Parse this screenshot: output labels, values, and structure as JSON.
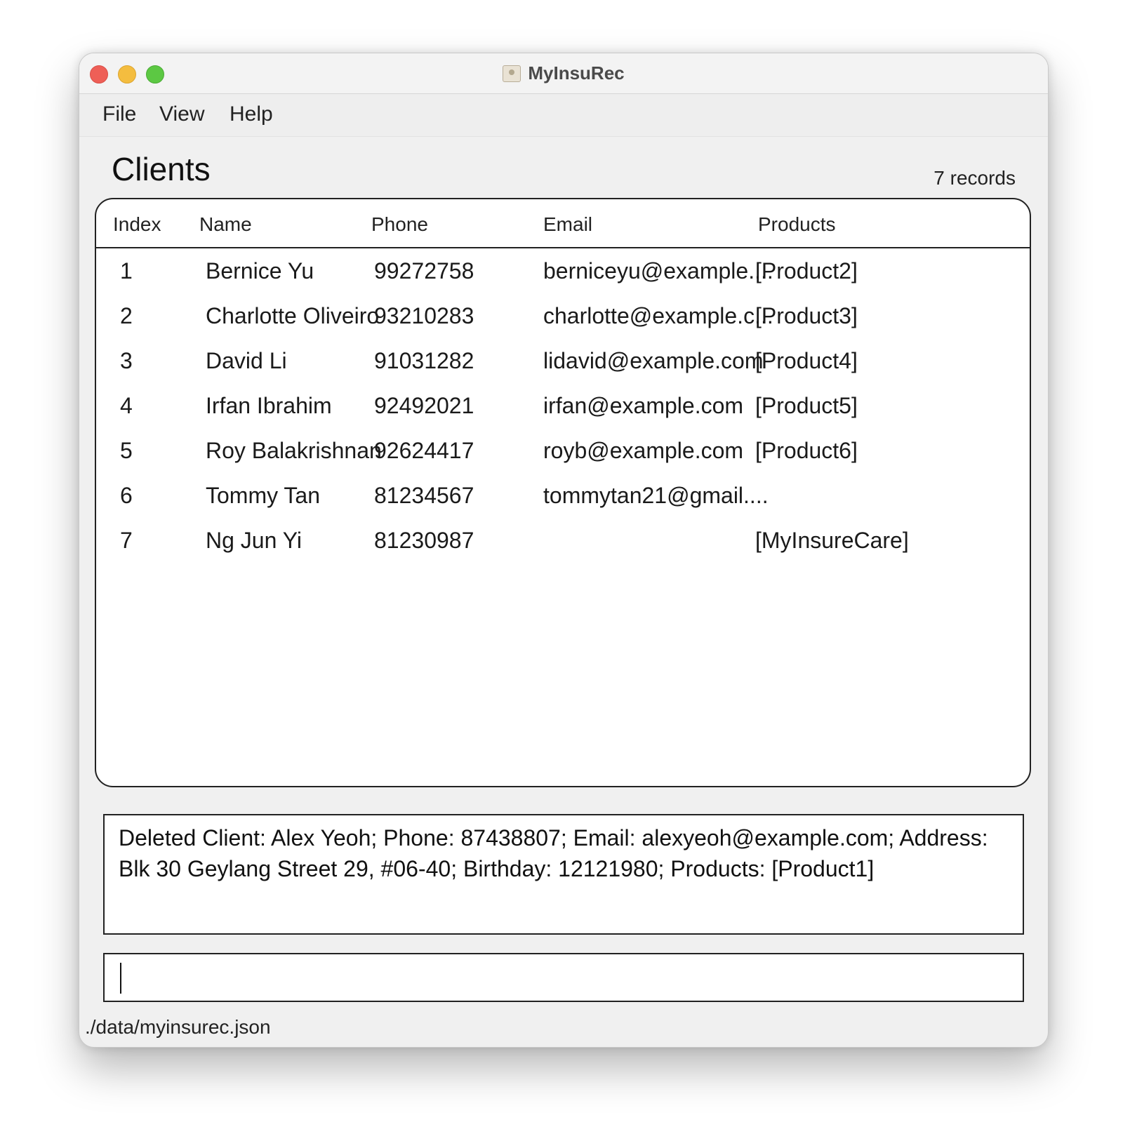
{
  "window": {
    "title": "MyInsuRec"
  },
  "menu": [
    "File",
    "View",
    "Help"
  ],
  "clients": {
    "heading": "Clients",
    "record_count": "7 records",
    "columns": [
      "Index",
      "Name",
      "Phone",
      "Email",
      "Products"
    ],
    "rows": [
      {
        "index": "1",
        "name": "Bernice Yu",
        "phone": "99272758",
        "email": "berniceyu@example....",
        "products": "[Product2]"
      },
      {
        "index": "2",
        "name": "Charlotte Oliveiro",
        "phone": "93210283",
        "email": "charlotte@example.c...",
        "products": "[Product3]"
      },
      {
        "index": "3",
        "name": "David Li",
        "phone": "91031282",
        "email": "lidavid@example.com",
        "products": "[Product4]"
      },
      {
        "index": "4",
        "name": "Irfan Ibrahim",
        "phone": "92492021",
        "email": "irfan@example.com",
        "products": "[Product5]"
      },
      {
        "index": "5",
        "name": "Roy Balakrishnan",
        "phone": "92624417",
        "email": "royb@example.com",
        "products": "[Product6]"
      },
      {
        "index": "6",
        "name": "Tommy Tan",
        "phone": "81234567",
        "email": "tommytan21@gmail....",
        "products": ""
      },
      {
        "index": "7",
        "name": "Ng Jun Yi",
        "phone": "81230987",
        "email": "",
        "products": "[MyInsureCare]"
      }
    ]
  },
  "result": {
    "text": "Deleted Client: Alex Yeoh; Phone: 87438807; Email: alexyeoh@example.com; Address: Blk 30 Geylang Street 29, #06-40; Birthday: 12121980; Products: [Product1]"
  },
  "command": {
    "value": ""
  },
  "status": {
    "file_path": "./data/myinsurec.json"
  }
}
